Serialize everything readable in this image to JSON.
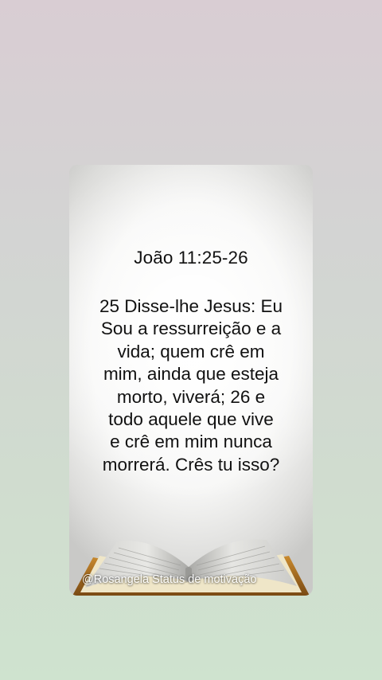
{
  "card": {
    "reference": "João 11:25-26",
    "lines": [
      "25 Disse-lhe Jesus: Eu",
      "Sou a ressurreição e a",
      "vida; quem crê em",
      "mim, ainda que esteja",
      "morto, viverá; 26 e",
      "todo aquele que vive",
      "e crê em mim nunca",
      "morrerá. Crês tu isso?"
    ],
    "image_icon": "open-bible-icon",
    "watermark": "@Rosangela Status de motivação"
  },
  "colors": {
    "text": "#111111",
    "background_top": "#d9cdd3",
    "background_bottom": "#cfe3cf",
    "book_cover": "#b8741f"
  }
}
